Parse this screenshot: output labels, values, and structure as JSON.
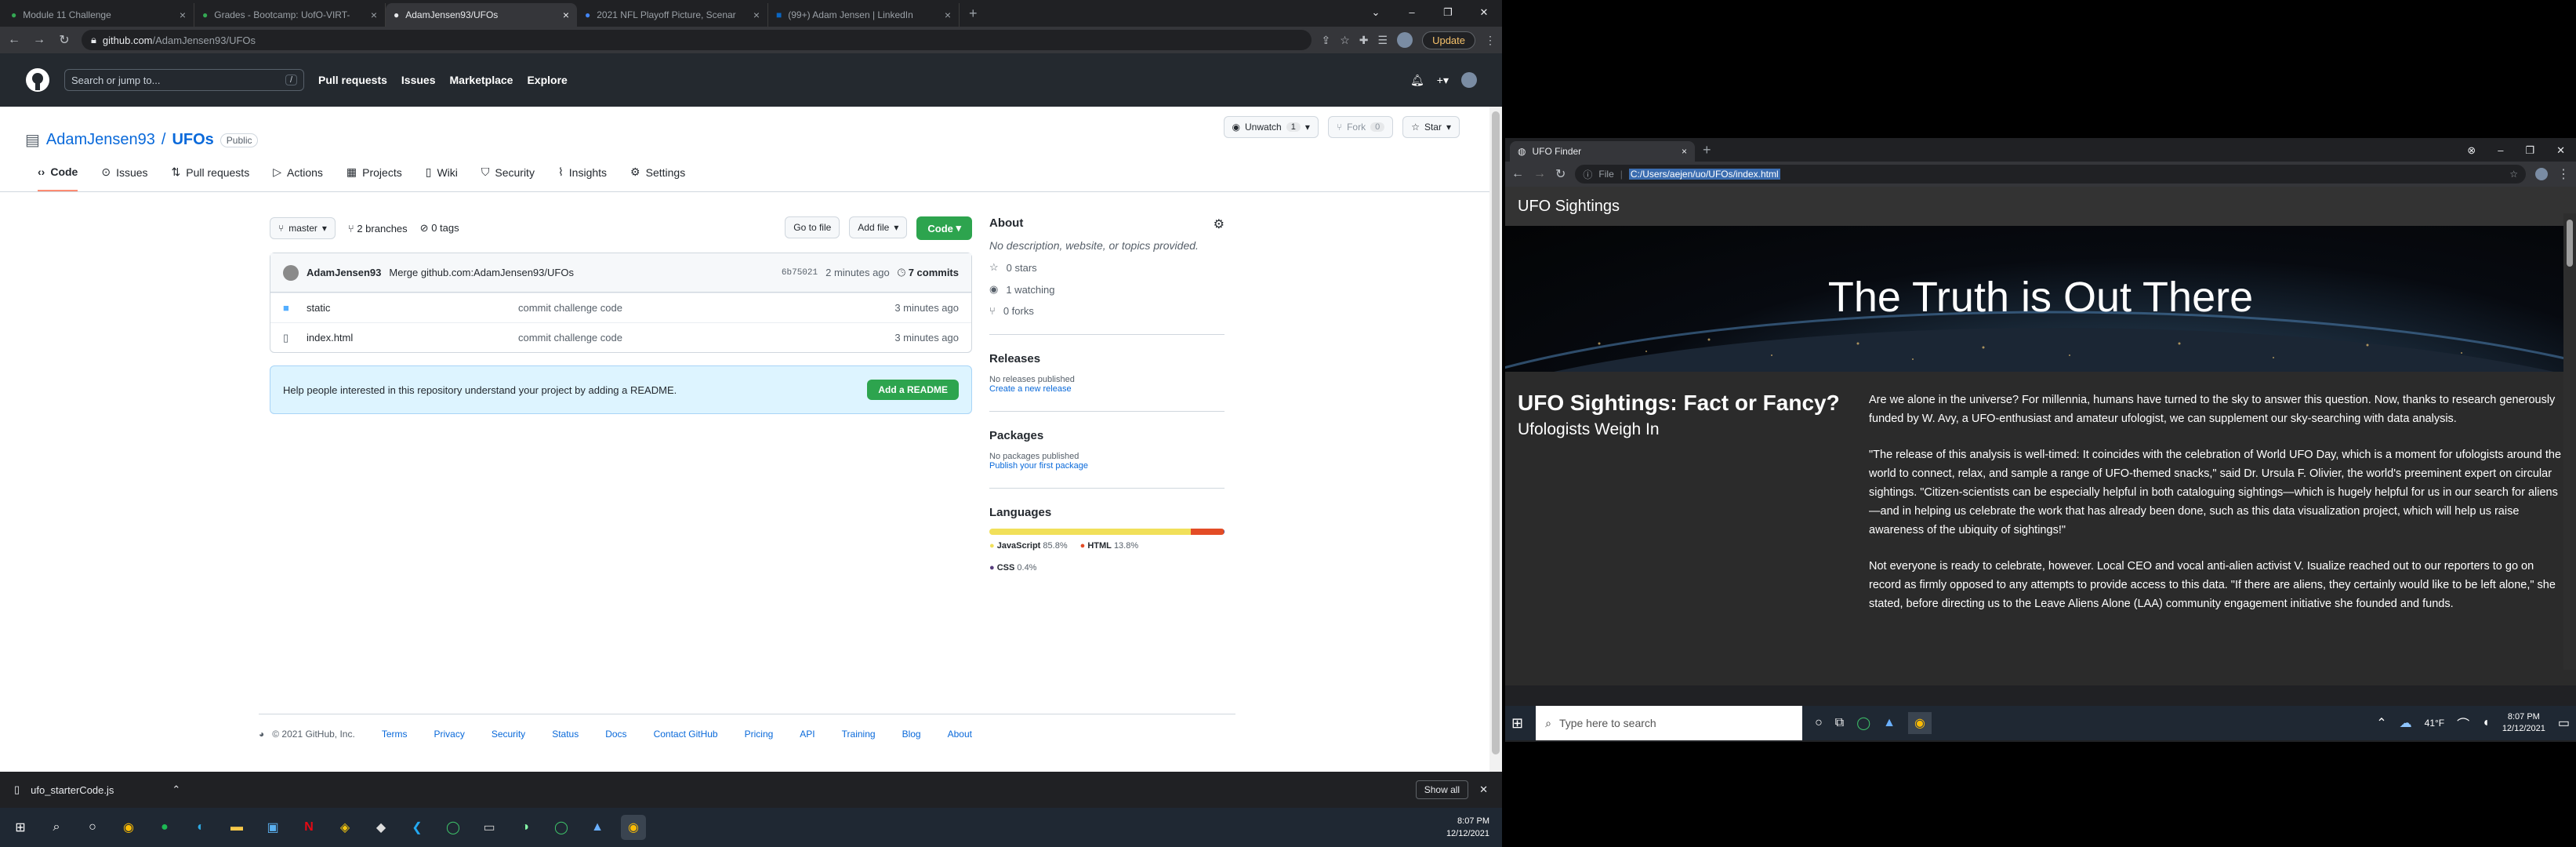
{
  "browser": {
    "tabs": [
      {
        "title": "Module 11 Challenge",
        "active": false
      },
      {
        "title": "Grades - Bootcamp: UofO-VIRT-",
        "active": false
      },
      {
        "title": "AdamJensen93/UFOs",
        "active": true
      },
      {
        "title": "2021 NFL Playoff Picture, Scenar",
        "active": false
      },
      {
        "title": "(99+) Adam Jensen | LinkedIn",
        "active": false
      }
    ],
    "url_host": "github.com",
    "url_path": "/AdamJensen93/UFOs",
    "update_label": "Update"
  },
  "github": {
    "search_placeholder": "Search or jump to...",
    "search_key": "/",
    "nav": [
      "Pull requests",
      "Issues",
      "Marketplace",
      "Explore"
    ],
    "owner": "AdamJensen93",
    "sep": "/",
    "repo": "UFOs",
    "visibility": "Public",
    "unwatch": {
      "label": "Unwatch",
      "count": "1"
    },
    "fork": {
      "label": "Fork",
      "count": "0"
    },
    "star": {
      "label": "Star"
    },
    "tabs": [
      "Code",
      "Issues",
      "Pull requests",
      "Actions",
      "Projects",
      "Wiki",
      "Security",
      "Insights",
      "Settings"
    ],
    "branch": "master",
    "branches": "2 branches",
    "tags": "0 tags",
    "go_to_file": "Go to file",
    "add_file": "Add file",
    "code": "Code",
    "commit": {
      "author": "AdamJensen93",
      "message": "Merge github.com:AdamJensen93/UFOs",
      "sha": "6b75021",
      "time": "2 minutes ago",
      "count": "7 commits"
    },
    "files": [
      {
        "name": "static",
        "message": "commit challenge code",
        "time": "3 minutes ago"
      },
      {
        "name": "index.html",
        "message": "commit challenge code",
        "time": "3 minutes ago"
      }
    ],
    "readme_prompt": "Help people interested in this repository understand your project by adding a README.",
    "add_readme": "Add a README",
    "about": {
      "title": "About",
      "desc": "No description, website, or topics provided.",
      "stars": "0 stars",
      "watching": "1 watching",
      "forks": "0 forks"
    },
    "releases": {
      "title": "Releases",
      "none": "No releases published",
      "create": "Create a new release"
    },
    "packages": {
      "title": "Packages",
      "none": "No packages published",
      "publish": "Publish your first package"
    },
    "languages": {
      "title": "Languages",
      "items": [
        {
          "name": "JavaScript",
          "pct": "85.8%",
          "value": 85.8,
          "color": "#f1e05a"
        },
        {
          "name": "HTML",
          "pct": "13.8%",
          "value": 13.8,
          "color": "#e34c26"
        },
        {
          "name": "CSS",
          "pct": "0.4%",
          "value": 0.4,
          "color": "#563d7c"
        }
      ]
    },
    "footer": {
      "copyright": "© 2021 GitHub, Inc.",
      "links": [
        "Terms",
        "Privacy",
        "Security",
        "Status",
        "Docs",
        "Contact GitHub",
        "Pricing",
        "API",
        "Training",
        "Blog",
        "About"
      ]
    }
  },
  "downloads": {
    "file": "ufo_starterCode.js",
    "show_all": "Show all"
  },
  "taskbar_left": {
    "time": "8:07 PM",
    "date": "12/12/2021"
  },
  "ufo_window": {
    "tab_title": "UFO Finder",
    "url_scheme": "File",
    "url": "C:/Users/aejen/uo/UFOs/index.html",
    "nav_brand": "UFO Sightings",
    "hero_title": "The Truth is Out There",
    "heading": "UFO Sightings: Fact or Fancy?",
    "subheading": "Ufologists Weigh In",
    "paragraphs": [
      "Are we alone in the universe? For millennia, humans have turned to the sky to answer this question. Now, thanks to research generously funded by W. Avy, a UFO-enthusiast and amateur ufologist, we can supplement our sky-searching with data analysis.",
      "\"The release of this analysis is well-timed: It coincides with the celebration of World UFO Day, which is a moment for ufologists around the world to connect, relax, and sample a range of UFO-themed snacks,\" said Dr. Ursula F. Olivier, the world's preeminent expert on circular sightings. \"Citizen-scientists can be especially helpful in both cataloguing sightings—which is hugely helpful for us in our search for aliens—and in helping us celebrate the work that has already been done, such as this data visualization project, which will help us raise awareness of the ubiquity of sightings!\"",
      "Not everyone is ready to celebrate, however. Local CEO and vocal anti-alien activist V. Isualize reached out to our reporters to go on record as firmly opposed to any attempts to provide access to this data. \"If there are aliens, they certainly would like to be left alone,\" she stated, before directing us to the Leave Aliens Alone (LAA) community engagement initiative she founded and funds."
    ]
  },
  "taskbar_right": {
    "search_placeholder": "Type here to search",
    "weather": "41°F",
    "time": "8:07 PM",
    "date": "12/12/2021"
  }
}
